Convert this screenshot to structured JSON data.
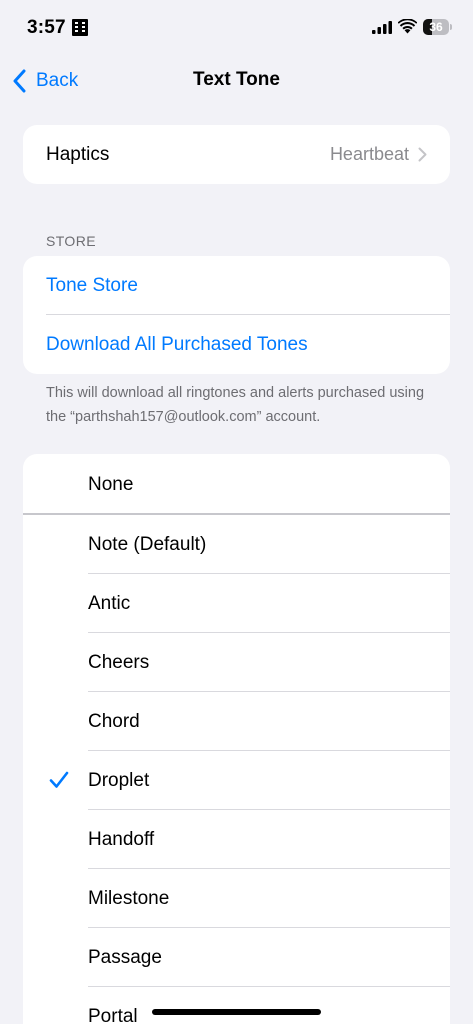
{
  "status_bar": {
    "time": "3:57",
    "battery_level": "36",
    "battery_fraction": 0.36
  },
  "nav": {
    "back_label": "Back",
    "title": "Text Tone"
  },
  "haptics": {
    "label": "Haptics",
    "value": "Heartbeat"
  },
  "store": {
    "header": "STORE",
    "items": [
      {
        "label": "Tone Store"
      },
      {
        "label": "Download All Purchased Tones"
      }
    ],
    "footer": "This will download all ringtones and alerts purchased using the “parthshah157@outlook.com” account."
  },
  "tones": {
    "none_label": "None",
    "selected": "Droplet",
    "items": [
      {
        "label": "Note (Default)"
      },
      {
        "label": "Antic"
      },
      {
        "label": "Cheers"
      },
      {
        "label": "Chord"
      },
      {
        "label": "Droplet"
      },
      {
        "label": "Handoff"
      },
      {
        "label": "Milestone"
      },
      {
        "label": "Passage"
      },
      {
        "label": "Portal"
      }
    ]
  },
  "colors": {
    "accent": "#007aff",
    "background": "#f2f2f7",
    "secondary_text": "#8a8a8e"
  }
}
